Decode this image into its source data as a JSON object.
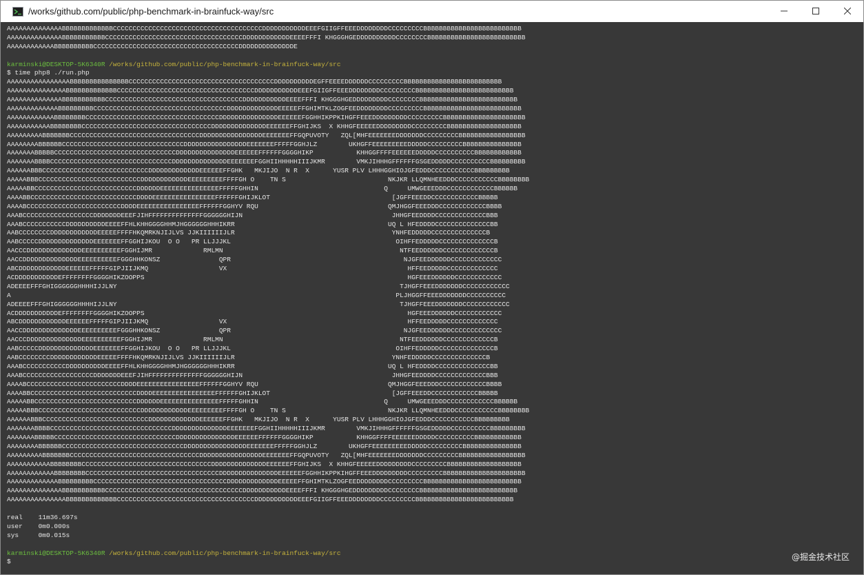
{
  "window": {
    "title": "/works/github.com/public/php-benchmark-in-brainfuck-way/src",
    "icon": "terminal-icon",
    "controls": [
      "minimize-icon",
      "maximize-icon",
      "close-icon"
    ]
  },
  "terminal": {
    "head_output": [
      "AAAAAAAAAAAAAABBBBBBBBBBBBBCCCCCCCCCCCCCCCCCCCCCCCCCCCCCCCCCCCCCCDDDDDDDDDDDEEEFGIIGFFEEEDDDDDDDDCCCCCCCCCBBBBBBBBBBBBBBBBBBBBBBBBB",
      "AAAAAAAAAAAAAABBBBBBBBBBBCCCCCCCCCCCCCCCCCCCCCCCCCCCCCCCCCCCDDDDDDDDDDDDEEEEFFFI KHGGGHGEDDDDDDDDDDCCCCCCCCBBBBBBBBBBBBBBBBBBBBBBBBB",
      "AAAAAAAAAAAABBBBBBBBBBCCCCCCCCCCCCCCCCCCCCCCCCCCCCCCCCCCCCCDDDDDDDDDDDDDDE"
    ],
    "prompt1": {
      "user": "karminski@DESKTOP-5K6340R",
      "path": "/works/github.com/public/php-benchmark-in-brainfuck-way/src"
    },
    "command": "$ time php8 ./run.php",
    "mandelbrot": [
      "AAAAAAAAAAAAAAAABBBBBBBBBBBBBBBCCCCCCCCCCCCCCCCCCCCCCCCCCCCCCCCCCCCCDDDDDDDDDDEGFFEEEEDDDDDDCCCCCCCCCBBBBBBBBBBBBBBBBBBBBBBBBB",
      "AAAAAAAAAAAAAAABBBBBBBBBBBBBCCCCCCCCCCCCCCCCCCCCCCCCCCCCCCCCCCCDDDDDDDDDDDEEEFGIIGFFEEEDDDDDDDDCCCCCCCCCBBBBBBBBBBBBBBBBBBBBBBBBB",
      "AAAAAAAAAAAAAABBBBBBBBBBBCCCCCCCCCCCCCCCCCCCCCCCCCCCCCCCCCCCDDDDDDDDDDDEEEEFFFI KHGGGHGEDDDDDDDDDCCCCCCCCBBBBBBBBBBBBBBBBBBBBBBBBB",
      "AAAAAAAAAAAAABBBBBBBBBCCCCCCCCCCCCCCCCCCCCCCCCCCCCCCCCCCDDDDDDDDDDDDDEEEEEFFGHIMTKLZOGFEEDDDDDDDDCCCCCCCCCBBBBBBBBBBBBBBBBBBBBBBBBB",
      "AAAAAAAAAAAABBBBBBBBCCCCCCCCCCCCCCCCCCCCCCCCCCCCCCCCCCDDDDDDDDDDDDDDDEEEEEEFGGHHIKPPKIHGFFEEEDDDDDDDDDCCCCCCCCCBBBBBBBBBBBBBBBBBBBBB",
      "AAAAAAAAAAABBBBBBBBCCCCCCCCCCCCCCCCCCCCCCCCCCCCCCCCCDDDDDDDDDDDDDDEEEEEEFFGHIJKS  X KHHGFEEEEEDDDDDDDDDCCCCCCCCCBBBBBBBBBBBBBBBBBBB",
      "AAAAAAAAABBBBBBBCCCCCCCCCCCCCCCCCCCCCCCCCCCCCCCCCDDDDDDDDDDDDDDDDEEEEEEEFFGQPUVOTY   ZQL[MHFEEEEEEEDDDDDDDCCCCCCCCCBBBBBBBBBBBBBBBBB",
      "AAAAAAAABBBBBBCCCCCCCCCCCCCCCCCCCCCCCCCCCCCCCDDDDDDDDDDDDDDDDEEEEEEEFFFFFGGHJLZ        UKHGFFEEEEEEEEEDDDDDCCCCCCCCCBBBBBBBBBBBBBBB",
      "AAAAAAABBBBBCCCCCCCCCCCCCCCCCCCCCCCCCCCCCCCDDDDDDDDDDDDDDDEEEEEEFFFFFFGGGGHIKP           KHHGGFFFFEEEEEEDDDDDCCCCCCCCCCBBBBBBBBBBBB",
      "AAAAAAABBBBCCCCCCCCCCCCCCCCCCCCCCCCCCCCCCCDDDDDDDDDDDDDDEEEEEEEFGGHIIHHHHHIIIJKMR        VMKJIHHHGFFFFFFGSGEDDDDDCCCCCCCCCCBBBBBBBBB",
      "AAAAAABBBCCCCCCCCCCCCCCCCCCCCCCCCCCCDDDDDDDDDDDDDEEEEEEFFGHK   MKJIJO  N R  X      YUSR PLV LHHHGGHIOJGFEDDDCCCCCCCCCCCBBBBBBBBB",
      "AAAAABBBCCCCCCCCCCCCCCCCCCCCCCCCCCDDDDDDDDDDDDEEEEEEEEEFFFFGH O    TN S                          NKJKR LLQMNHEEDDDCCCCCCCCCCCBBBBBBBB",
      "AAAAABBCCCCCCCCCCCCCCCCCCCCCCCCCCDDDDDDEEEEEEEEEEEEEEEFFFFFGHHIN                                Q     UMWGEEEDDDCCCCCCCCCCCCBBBBBB",
      "AAAABBCCCCCCCCCCCCCCCCCCCCCCCCCCCDDDDEEEEEEEEEEEEEEEEFFFFFFGHIJKLOT                               [JGFFEEEDDCCCCCCCCCCCCBBBBB",
      "AAAABCCCCCCCCCCCCCCCCCCCCCCCCDDDDEEEEEEEEEEEEEEEEFFFFFFGGHYV RQU                                 QMJHGGFEEEDDDCCCCCCCCCCCCBBBB",
      "AAABCCCCCCCCCCCCCCCCCCDDDDDDDEEEFJIHFFFFFFFFFFFFFFGGGGGGHIJN                                      JHHGFEEDDDDCCCCCCCCCCCCCBBB",
      "AAABCCCCCCCCCCCDDDDDDDDDDEEEEFFHLKHHGGGGHHMJHGGGGGGHHHIKRR                                       UQ L HFEDDDDCCCCCCCCCCCCCCBB",
      "AABCCCCCCCCDDDDDDDDDDDDEEEEEFFFFHKQMRKNJIJLVS JJKIIIIIIJLR                                        YNHFEDDDDDCCCCCCCCCCCCCCB",
      "AABCCCCCDDDDDDDDDDDDDDEEEEEEEFFGGHIJKOU  O O   PR LLJJJKL                                          OIHFFEDDDDDCCCCCCCCCCCCCCB",
      "AACCCDDDDDDDDDDDDDDEEEEEEEEEEFGGHIJMR             RMLMN                                             NTFEEDDDDDDCCCCCCCCCCCCCB",
      "AACCDDDDDDDDDDDDDDEEEEEEEEEEFGGGHHKONSZ               QPR                                            NJGFEEDDDDDDCCCCCCCCCCCCC",
      "ABCDDDDDDDDDDDDEEEEEEFFFFFGIPJIIJKMQ                  VX                                              HFFEEDDDDDCCCCCCCCCCCCC",
      "ACDDDDDDDDDDDEFFFFFFFFGGGGHIKZOOPPS                                                                   HGFEEEDDDDDDCCCCCCCCCCCC",
      "ADEEEEFFFGHIGGGGGGHHHHIJJLNY                                                                        TJHGFFEEEDDDDDDDCCCCCCCCCCCC",
      "A                                                                                                  PLJHGGFFEEEDDDDDDDCCCCCCCCCC",
      "ADEEEEFFFGHIGGGGGGHHHHIJJLNY                                                                        TJHGFFEEEDDDDDDDCCCCCCCCCCCC",
      "ACDDDDDDDDDDDEFFFFFFFFGGGGHIKZOOPPS                                                                   HGFEEEDDDDDDCCCCCCCCCCCC",
      "ABCDDDDDDDDDDDDEEEEEEFFFFFGIPJIIJKMQ                  VX                                              HFFEEDDDDDCCCCCCCCCCCCC",
      "AACCDDDDDDDDDDDDDDEEEEEEEEEEFGGGHHKONSZ               QPR                                            NJGFEEDDDDDDCCCCCCCCCCCCC",
      "AACCCDDDDDDDDDDDDDDEEEEEEEEEEFGGHIJMR             RMLMN                                             NTFEEDDDDDDCCCCCCCCCCCCCB",
      "AABCCCCCDDDDDDDDDDDDDDEEEEEEEFFGGHIJKOU  O O   PR LLJJJKL                                          OIHFFEDDDDDCCCCCCCCCCCCCCB",
      "AABCCCCCCCCDDDDDDDDDDDDEEEEEFFFFHKQMRKNJIJLVS JJKIIIIIIJLR                                        YNHFEDDDDDCCCCCCCCCCCCCCB",
      "AAABCCCCCCCCCCCDDDDDDDDDDEEEEFFHLKHHGGGGHHMJHGGGGGGHHHIKRR                                       UQ L HFEDDDDCCCCCCCCCCCCCCBB",
      "AAABCCCCCCCCCCCCCCCCCCDDDDDDDEEEFJIHFFFFFFFFFFFFFFGGGGGGHIJN                                      JHHGFEEDDDDCCCCCCCCCCCCCBBB",
      "AAAABCCCCCCCCCCCCCCCCCCCCCCCCDDDDEEEEEEEEEEEEEEEEFFFFFFGGHYV RQU                                 QMJHGGFEEEDDDCCCCCCCCCCCCBBBB",
      "AAAABBCCCCCCCCCCCCCCCCCCCCCCCCCCCDDDDEEEEEEEEEEEEEEEEFFFFFFGHIJKLOT                               [JGFFEEEDDCCCCCCCCCCCCBBBBB",
      "AAAAABBCCCCCCCCCCCCCCCCCCCCCCCCCCDDDDDDEEEEEEEEEEEEEEEFFFFFGHHIN                                Q     UMWGEEEDDDCCCCCCCCCCCCBBBBBB",
      "AAAAABBBCCCCCCCCCCCCCCCCCCCCCCCCCCDDDDDDDDDDDDEEEEEEEEEFFFFGH O    TN S                          NKJKR LLQMNHEEDDDCCCCCCCCCCCBBBBBBBB",
      "AAAAAABBBCCCCCCCCCCCCCCCCCCCCCCCCCCCDDDDDDDDDDDDDEEEEEEFFGHK   MKJIJO  N R  X      YUSR PLV LHHHGGHIOJGFEDDDCCCCCCCCCCCBBBBBBBBB",
      "AAAAAAABBBBCCCCCCCCCCCCCCCCCCCCCCCCCCCCCCCDDDDDDDDDDDDDDEEEEEEEFGGHIIHHHHHIIIJKMR        VMKJIHHHGFFFFFFGSGEDDDDDCCCCCCCCCCBBBBBBBBB",
      "AAAAAAABBBBBCCCCCCCCCCCCCCCCCCCCCCCCCCCCCCCDDDDDDDDDDDDDDDEEEEEEFFFFFFGGGGHIKP           KHHGGFFFFEEEEEEDDDDDCCCCCCCCCCBBBBBBBBBBBB",
      "AAAAAAAABBBBBBCCCCCCCCCCCCCCCCCCCCCCCCCCCCCCCDDDDDDDDDDDDDDDDEEEEEEEFFFFFGGHJLZ        UKHGFFEEEEEEEEEDDDDDCCCCCCCCCBBBBBBBBBBBBBBB",
      "AAAAAAAAABBBBBBBCCCCCCCCCCCCCCCCCCCCCCCCCCCCCCCCCDDDDDDDDDDDDDDDDEEEEEEEFFGQPUVOTY   ZQL[MHFEEEEEEEDDDDDDDCCCCCCCCCBBBBBBBBBBBBBBBBB",
      "AAAAAAAAAAABBBBBBBBCCCCCCCCCCCCCCCCCCCCCCCCCCCCCCCCCDDDDDDDDDDDDDDEEEEEEFFGHIJKS  X KHHGFEEEEEDDDDDDDDDCCCCCCCCCBBBBBBBBBBBBBBBBBBB",
      "AAAAAAAAAAAABBBBBBBBCCCCCCCCCCCCCCCCCCCCCCCCCCCCCCCCCCDDDDDDDDDDDDDDDEEEEEEFGGHHIKPPKIHGFFEEEDDDDDDDDDCCCCCCCCCBBBBBBBBBBBBBBBBBBBBB",
      "AAAAAAAAAAAAABBBBBBBBBCCCCCCCCCCCCCCCCCCCCCCCCCCCCCCCCCCDDDDDDDDDDDDDEEEEEFFGHIMTKLZOGFEEDDDDDDDDCCCCCCCCCBBBBBBBBBBBBBBBBBBBBBBBBB",
      "AAAAAAAAAAAAAABBBBBBBBBBBCCCCCCCCCCCCCCCCCCCCCCCCCCCCCCCCCCCDDDDDDDDDDDEEEEFFFI KHGGGHGEDDDDDDDDDCCCCCCCCBBBBBBBBBBBBBBBBBBBBBBBBB",
      "AAAAAAAAAAAAAAABBBBBBBBBBBBBCCCCCCCCCCCCCCCCCCCCCCCCCCCCCCCCCCCDDDDDDDDDDDEEEFGIIGFFEEEDDDDDDDDCCCCCCCCCBBBBBBBBBBBBBBBBBBBBBBBBB"
    ],
    "timing": {
      "real": "real\t11m36.697s",
      "user": "user\t0m0.000s",
      "sys": "sys\t0m0.015s"
    },
    "prompt2": {
      "user": "karminski@DESKTOP-5K6340R",
      "path": "/works/github.com/public/php-benchmark-in-brainfuck-way/src"
    },
    "cursor_line": "$"
  },
  "watermark": "@掘金技术社区",
  "colors": {
    "terminal_bg": "#383838",
    "prompt_user": "#6cbf3f",
    "prompt_path": "#c6b33c",
    "text": "#e6e6e6"
  }
}
